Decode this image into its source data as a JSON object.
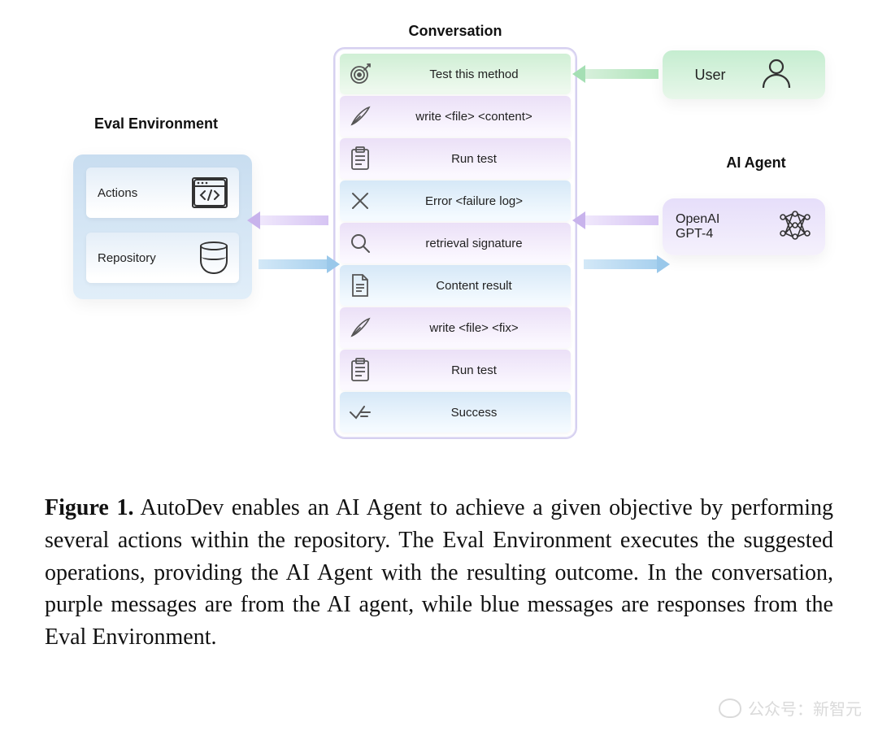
{
  "sections": {
    "eval_title": "Eval Environment",
    "conversation_title": "Conversation",
    "agent_title": "AI Agent"
  },
  "eval": {
    "actions": "Actions",
    "repository": "Repository"
  },
  "user_box": "User",
  "agent_box": {
    "line1": "OpenAI",
    "line2": "GPT-4"
  },
  "messages": [
    {
      "text": "Test this method",
      "kind": "green",
      "icon": "target-icon"
    },
    {
      "text": "write <file> <content>",
      "kind": "purple",
      "icon": "quill-icon"
    },
    {
      "text": "Run test",
      "kind": "purple",
      "icon": "clipboard-icon"
    },
    {
      "text": "Error <failure log>",
      "kind": "blue",
      "icon": "x-icon"
    },
    {
      "text": "retrieval signature",
      "kind": "purple",
      "icon": "search-icon"
    },
    {
      "text": "Content result",
      "kind": "blue",
      "icon": "document-icon"
    },
    {
      "text": "write <file> <fix>",
      "kind": "purple",
      "icon": "quill-icon"
    },
    {
      "text": "Run test",
      "kind": "purple",
      "icon": "clipboard-icon"
    },
    {
      "text": "Success",
      "kind": "blue",
      "icon": "check-icon"
    }
  ],
  "caption": {
    "label": "Figure 1.",
    "text": " AutoDev enables an AI Agent to achieve a given objective by performing several actions within the repository. The Eval Environment executes the suggested operations, providing the AI Agent with the resulting outcome. In the conversation, purple messages are from the AI agent, while blue messages are responses from the Eval Environment."
  },
  "watermark": "公众号：新智元"
}
